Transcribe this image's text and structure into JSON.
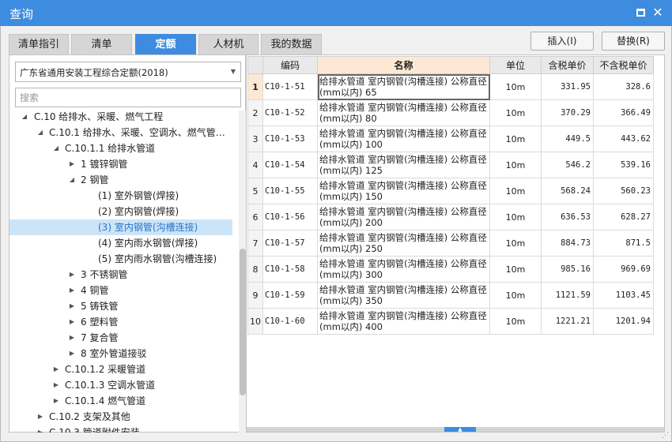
{
  "window": {
    "title": "查询"
  },
  "tabs": [
    {
      "label": "清单指引",
      "active": false
    },
    {
      "label": "清单",
      "active": false
    },
    {
      "label": "定额",
      "active": true
    },
    {
      "label": "人材机",
      "active": false
    },
    {
      "label": "我的数据",
      "active": false
    }
  ],
  "buttons": {
    "insert": "插入(I)",
    "replace": "替换(R)"
  },
  "left": {
    "library": "广东省通用安装工程综合定额(2018)",
    "search_placeholder": "搜索",
    "tree": [
      {
        "label": "C.10 给排水、采暖、燃气工程",
        "toggle": "expanded",
        "selected": false
      },
      {
        "label": "C.10.1 给排水、采暖、空调水、燃气管…",
        "toggle": "expanded",
        "selected": false
      },
      {
        "label": "C.10.1.1 给排水管道",
        "toggle": "expanded",
        "selected": false
      },
      {
        "label": "1 镀锌钢管",
        "toggle": "collapsed",
        "selected": false
      },
      {
        "label": "2 钢管",
        "toggle": "expanded",
        "selected": false
      },
      {
        "label": "(1) 室外钢管(焊接)",
        "toggle": "none",
        "selected": false
      },
      {
        "label": "(2) 室内钢管(焊接)",
        "toggle": "none",
        "selected": false
      },
      {
        "label": "(3) 室内钢管(沟槽连接)",
        "toggle": "none",
        "selected": true
      },
      {
        "label": "(4) 室内雨水钢管(焊接)",
        "toggle": "none",
        "selected": false
      },
      {
        "label": "(5) 室内雨水钢管(沟槽连接)",
        "toggle": "none",
        "selected": false
      },
      {
        "label": "3 不锈钢管",
        "toggle": "collapsed",
        "selected": false
      },
      {
        "label": "4 铜管",
        "toggle": "collapsed",
        "selected": false
      },
      {
        "label": "5 铸铁管",
        "toggle": "collapsed",
        "selected": false
      },
      {
        "label": "6 塑料管",
        "toggle": "collapsed",
        "selected": false
      },
      {
        "label": "7 复合管",
        "toggle": "collapsed",
        "selected": false
      },
      {
        "label": "8 室外管道接驳",
        "toggle": "collapsed",
        "selected": false
      },
      {
        "label": "C.10.1.2 采暖管道",
        "toggle": "collapsed",
        "selected": false
      },
      {
        "label": "C.10.1.3 空调水管道",
        "toggle": "collapsed",
        "selected": false
      },
      {
        "label": "C.10.1.4 燃气管道",
        "toggle": "collapsed",
        "selected": false
      },
      {
        "label": "C.10.2 支架及其他",
        "toggle": "collapsed",
        "selected": false
      },
      {
        "label": "C.10.3 管道附件安装",
        "toggle": "collapsed",
        "selected": false
      }
    ]
  },
  "table": {
    "columns": [
      "",
      "编码",
      "名称",
      "单位",
      "含税单价",
      "不含税单价"
    ],
    "rows": [
      {
        "index": "1",
        "code": "C10-1-51",
        "name": "给排水管道 室内钢管(沟槽连接) 公称直径(mm以内) 65",
        "unit": "10m",
        "price_tax": "331.95",
        "price_notax": "328.6"
      },
      {
        "index": "2",
        "code": "C10-1-52",
        "name": "给排水管道 室内钢管(沟槽连接) 公称直径(mm以内) 80",
        "unit": "10m",
        "price_tax": "370.29",
        "price_notax": "366.49"
      },
      {
        "index": "3",
        "code": "C10-1-53",
        "name": "给排水管道 室内钢管(沟槽连接) 公称直径(mm以内) 100",
        "unit": "10m",
        "price_tax": "449.5",
        "price_notax": "443.62"
      },
      {
        "index": "4",
        "code": "C10-1-54",
        "name": "给排水管道 室内钢管(沟槽连接) 公称直径(mm以内) 125",
        "unit": "10m",
        "price_tax": "546.2",
        "price_notax": "539.16"
      },
      {
        "index": "5",
        "code": "C10-1-55",
        "name": "给排水管道 室内钢管(沟槽连接) 公称直径(mm以内) 150",
        "unit": "10m",
        "price_tax": "568.24",
        "price_notax": "560.23"
      },
      {
        "index": "6",
        "code": "C10-1-56",
        "name": "给排水管道 室内钢管(沟槽连接) 公称直径(mm以内) 200",
        "unit": "10m",
        "price_tax": "636.53",
        "price_notax": "628.27"
      },
      {
        "index": "7",
        "code": "C10-1-57",
        "name": "给排水管道 室内钢管(沟槽连接) 公称直径(mm以内) 250",
        "unit": "10m",
        "price_tax": "884.73",
        "price_notax": "871.5"
      },
      {
        "index": "8",
        "code": "C10-1-58",
        "name": "给排水管道 室内钢管(沟槽连接) 公称直径(mm以内) 300",
        "unit": "10m",
        "price_tax": "985.16",
        "price_notax": "969.69"
      },
      {
        "index": "9",
        "code": "C10-1-59",
        "name": "给排水管道 室内钢管(沟槽连接) 公称直径(mm以内) 350",
        "unit": "10m",
        "price_tax": "1121.59",
        "price_notax": "1103.45"
      },
      {
        "index": "10",
        "code": "C10-1-60",
        "name": "给排水管道 室内钢管(沟槽连接) 公称直径(mm以内) 400",
        "unit": "10m",
        "price_tax": "1221.21",
        "price_notax": "1201.94"
      }
    ]
  },
  "colors": {
    "accent": "#3d8ce0",
    "highlight": "#fde9d3",
    "selected": "#cce4f7"
  }
}
